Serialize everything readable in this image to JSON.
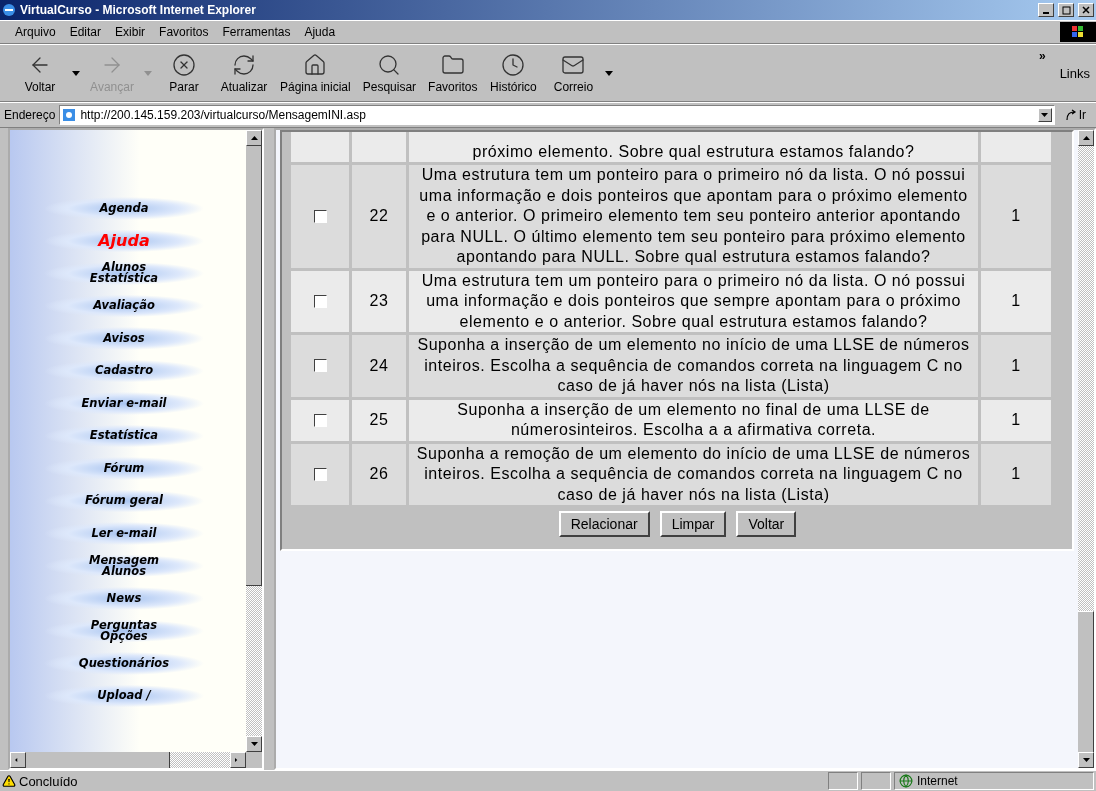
{
  "window": {
    "title": "VirtualCurso - Microsoft Internet Explorer"
  },
  "menu": [
    "Arquivo",
    "Editar",
    "Exibir",
    "Favoritos",
    "Ferramentas",
    "Ajuda"
  ],
  "toolbar": [
    {
      "kind": "back",
      "label": "Voltar",
      "disabled": false,
      "dropdown": true
    },
    {
      "kind": "forward",
      "label": "Avançar",
      "disabled": true,
      "dropdown": true
    },
    {
      "kind": "stop",
      "label": "Parar",
      "disabled": false,
      "dropdown": false
    },
    {
      "kind": "refresh",
      "label": "Atualizar",
      "disabled": false,
      "dropdown": false
    },
    {
      "kind": "home",
      "label": "Página inicial",
      "disabled": false,
      "dropdown": false
    },
    {
      "kind": "search",
      "label": "Pesquisar",
      "disabled": false,
      "dropdown": false
    },
    {
      "kind": "favorites",
      "label": "Favoritos",
      "disabled": false,
      "dropdown": false
    },
    {
      "kind": "history",
      "label": "Histórico",
      "disabled": false,
      "dropdown": false
    },
    {
      "kind": "mail",
      "label": "Correio",
      "disabled": false,
      "dropdown": true
    }
  ],
  "toolbar_more": "»",
  "links": "Links",
  "address": {
    "label": "Endereço",
    "value": "http://200.145.159.203/virtualcurso/MensagemINI.asp",
    "go": "Ir"
  },
  "sidebar": {
    "items": [
      {
        "label": "Agenda",
        "selected": false
      },
      {
        "label": "Ajuda",
        "selected": true
      },
      {
        "label": "Alunos Estatística",
        "selected": false
      },
      {
        "label": "Avaliação",
        "selected": false
      },
      {
        "label": "Avisos",
        "selected": false
      },
      {
        "label": "Cadastro",
        "selected": false
      },
      {
        "label": "Enviar e-mail",
        "selected": false
      },
      {
        "label": "Estatística",
        "selected": false
      },
      {
        "label": "Fórum",
        "selected": false
      },
      {
        "label": "Fórum geral",
        "selected": false
      },
      {
        "label": "Ler e-mail",
        "selected": false
      },
      {
        "label": "Mensagem Alunos",
        "selected": false
      },
      {
        "label": "News",
        "selected": false
      },
      {
        "label": "Perguntas Opções",
        "selected": false
      },
      {
        "label": "Questionários",
        "selected": false
      },
      {
        "label": "Upload /",
        "selected": false
      }
    ]
  },
  "table": {
    "partial_row": {
      "text": "próximo elemento. Sobre qual estrutura estamos falando?"
    },
    "rows": [
      {
        "checked": false,
        "number": "22",
        "text": "Uma estrutura tem um ponteiro para o primeiro nó da lista. O nó possui uma informação e dois ponteiros que apontam para o próximo elemento e o anterior. O primeiro elemento tem seu ponteiro anterior apontando para NULL. O último elemento tem seu ponteiro para próximo elemento apontando para NULL. Sobre qual estrutura estamos falando?",
        "value": "1"
      },
      {
        "checked": false,
        "number": "23",
        "text": "Uma estrutura tem um ponteiro para o primeiro nó da lista. O nó possui uma informação e dois ponteiros que sempre apontam para o próximo elemento e o anterior. Sobre qual estrutura estamos falando?",
        "value": "1"
      },
      {
        "checked": false,
        "number": "24",
        "text": "Suponha a inserção de um elemento no início de uma LLSE de números inteiros. Escolha a sequência de comandos correta na linguagem C no caso de já haver nós na lista (Lista)",
        "value": "1"
      },
      {
        "checked": false,
        "number": "25",
        "text": "Suponha a inserção de um elemento no final de uma LLSE de númerosinteiros. Escolha a a afirmativa correta.",
        "value": "1"
      },
      {
        "checked": false,
        "number": "26",
        "text": "Suponha a remoção de um elemento do início de uma LLSE de números inteiros. Escolha a sequência de comandos correta na linguagem C no caso de já haver nós na lista (Lista)",
        "value": "1"
      }
    ]
  },
  "buttons": [
    "Relacionar",
    "Limpar",
    "Voltar"
  ],
  "status_bar": {
    "text": "Concluído",
    "zone": "Internet"
  }
}
